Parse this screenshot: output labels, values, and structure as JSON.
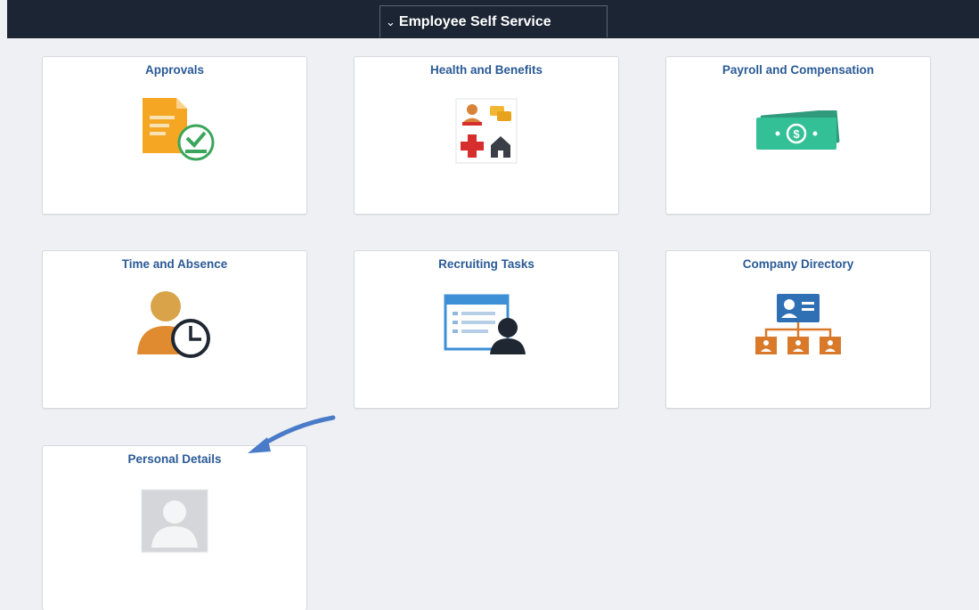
{
  "header": {
    "homepage_label": "Employee Self Service",
    "chevron": "⌄"
  },
  "tiles": [
    {
      "title": "Approvals",
      "icon": "approvals-document-check-icon"
    },
    {
      "title": "Health and Benefits",
      "icon": "health-benefits-icon"
    },
    {
      "title": "Payroll and Compensation",
      "icon": "money-bill-icon"
    },
    {
      "title": "Time and Absence",
      "icon": "person-clock-icon"
    },
    {
      "title": "Recruiting Tasks",
      "icon": "recruiting-form-person-icon"
    },
    {
      "title": "Company Directory",
      "icon": "org-chart-icon"
    },
    {
      "title": "Personal Details",
      "icon": "person-placeholder-icon"
    }
  ],
  "annotation": {
    "icon": "pointer-arrow-icon",
    "color": "#4a7bc8"
  },
  "colors": {
    "topbar": "#1c2533",
    "tile_title": "#2a5a96",
    "background": "#eef0f3"
  }
}
